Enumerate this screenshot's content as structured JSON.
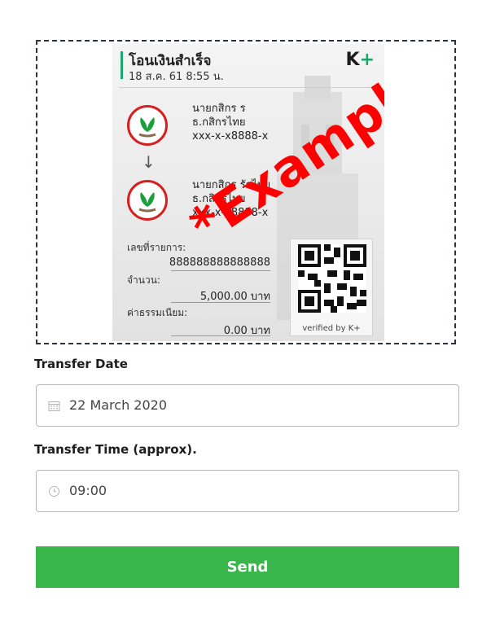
{
  "example_slip": {
    "title": "โอนเงินสำเร็จ",
    "datetime": "18 ส.ค. 61  8:55 น.",
    "logo_text": "K",
    "logo_plus": "+",
    "sender": {
      "name": "นายกสิกร ร",
      "bank": "ธ.กสิกรไทย",
      "account": "xxx-x-x8888-x"
    },
    "receiver": {
      "name": "นายกสิกร รักไทย",
      "bank": "ธ.กสิกรไทย",
      "account": "xxx-x-x8888-x"
    },
    "reference_label": "เลขที่รายการ:",
    "reference_value": "888888888888888",
    "amount_label": "จำนวน:",
    "amount_value": "5,000.00 บาท",
    "fee_label": "ค่าธรรมเนียม:",
    "fee_value": "0.00 บาท",
    "qr_caption": "verified by K+",
    "watermark": "*Example*",
    "watermark_color": "#ff0000"
  },
  "transfer_date": {
    "label": "Transfer Date",
    "value": "22 March 2020",
    "icon": "calendar-icon"
  },
  "transfer_time": {
    "label": "Transfer Time (approx).",
    "value": "09:00",
    "icon": "clock-icon"
  },
  "send_button": {
    "label": "Send",
    "color": "#3ab54a"
  }
}
